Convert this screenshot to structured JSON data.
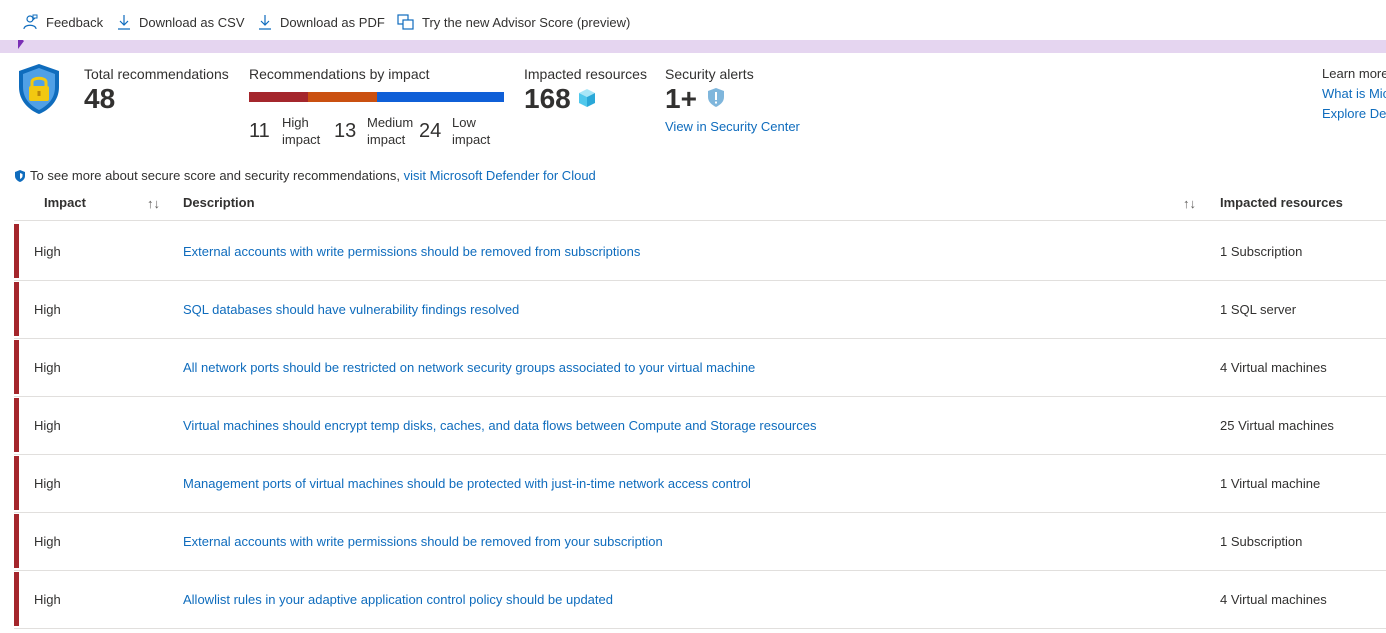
{
  "toolbar": {
    "feedback": "Feedback",
    "download_csv": "Download as CSV",
    "download_pdf": "Download as PDF",
    "advisor_score": "Try the new Advisor Score (preview)"
  },
  "summary": {
    "total_label": "Total recommendations",
    "total_value": "48",
    "by_impact_label": "Recommendations by impact",
    "high_count": "11",
    "high_label": "High impact",
    "medium_count": "13",
    "medium_label": "Medium impact",
    "low_count": "24",
    "low_label": "Low impact",
    "resources_label": "Impacted resources",
    "resources_value": "168",
    "alerts_label": "Security alerts",
    "alerts_value": "1+",
    "alerts_link": "View in Security Center",
    "learn_more_label": "Learn more",
    "learn_link_1": "What is Mic",
    "learn_link_2": "Explore Def"
  },
  "impact_colors": {
    "high": "#a4262c",
    "medium": "#ca5010",
    "low": "#0f5fd7"
  },
  "note": {
    "text": "To see more about secure score and security recommendations,",
    "link": "visit Microsoft Defender for Cloud"
  },
  "table": {
    "headers": {
      "impact": "Impact",
      "description": "Description",
      "resources": "Impacted resources"
    },
    "rows": [
      {
        "impact": "High",
        "description": "External accounts with write permissions should be removed from subscriptions",
        "resources": "1 Subscription"
      },
      {
        "impact": "High",
        "description": "SQL databases should have vulnerability findings resolved",
        "resources": "1 SQL server"
      },
      {
        "impact": "High",
        "description": "All network ports should be restricted on network security groups associated to your virtual machine",
        "resources": "4 Virtual machines"
      },
      {
        "impact": "High",
        "description": "Virtual machines should encrypt temp disks, caches, and data flows between Compute and Storage resources",
        "resources": "25 Virtual machines"
      },
      {
        "impact": "High",
        "description": "Management ports of virtual machines should be protected with just-in-time network access control",
        "resources": "1 Virtual machine"
      },
      {
        "impact": "High",
        "description": "External accounts with write permissions should be removed from your subscription",
        "resources": "1 Subscription"
      },
      {
        "impact": "High",
        "description": "Allowlist rules in your adaptive application control policy should be updated",
        "resources": "4 Virtual machines"
      }
    ]
  }
}
